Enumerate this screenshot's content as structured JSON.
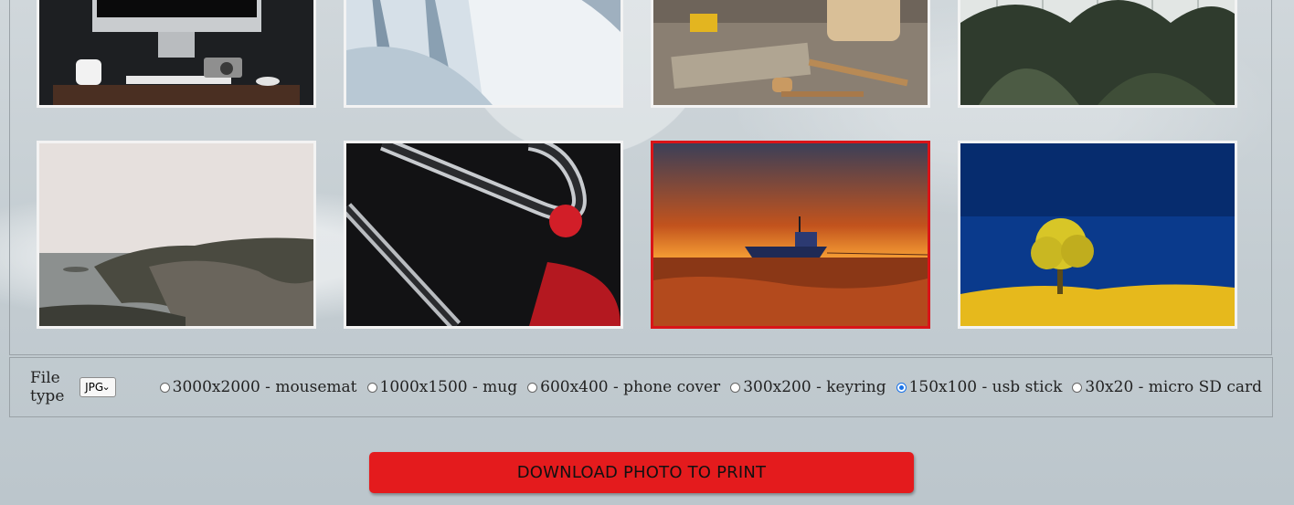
{
  "controls": {
    "file_type_label": "File type",
    "file_type_selected": "JPG",
    "sizes": [
      {
        "label": "3000x2000 - mousemat",
        "checked": false
      },
      {
        "label": "1000x1500 - mug",
        "checked": false
      },
      {
        "label": "600x400 - phone cover",
        "checked": false
      },
      {
        "label": "300x200 - keyring",
        "checked": false
      },
      {
        "label": "150x100 - usb stick",
        "checked": true
      },
      {
        "label": "30x20 - micro SD card",
        "checked": false
      }
    ]
  },
  "download": {
    "label": "DOWNLOAD PHOTO TO PRINT"
  },
  "colors": {
    "accent": "#e41b1d",
    "selected_border": "#d91418",
    "radio_checked": "#1a73e8"
  }
}
